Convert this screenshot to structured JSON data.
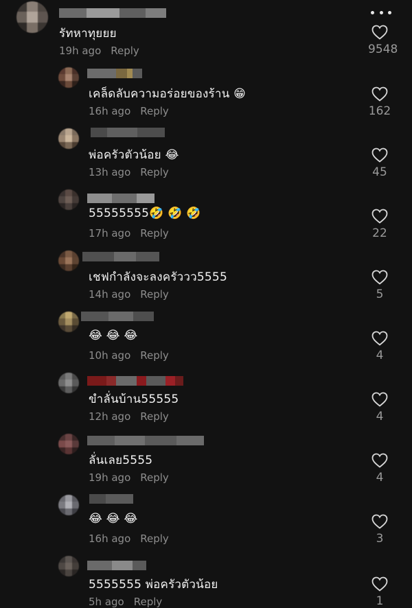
{
  "top_comment": {
    "text": "รัทหาทุยยย",
    "time": "19h ago",
    "reply": "Reply",
    "likes": "9548"
  },
  "replies": [
    {
      "text": "เคล็ดลับความอร่อยของร้าน 😁",
      "time": "16h ago",
      "reply": "Reply",
      "likes": "162"
    },
    {
      "text": "พ่อครัวตัวน้อย 😂",
      "time": "13h ago",
      "reply": "Reply",
      "likes": "45"
    },
    {
      "text": "55555555🤣 🤣 🤣",
      "time": "17h ago",
      "reply": "Reply",
      "likes": "22"
    },
    {
      "text": "เชฟกำลังจะลงครัววว5555",
      "time": "14h ago",
      "reply": "Reply",
      "likes": "5"
    },
    {
      "text": "😂 😂 😂",
      "time": "10h ago",
      "reply": "Reply",
      "likes": "4"
    },
    {
      "text": "ขำลั่นบ้าน55555",
      "time": "12h ago",
      "reply": "Reply",
      "likes": "4"
    },
    {
      "text": "ลั่นเลย5555",
      "time": "19h ago",
      "reply": "Reply",
      "likes": "4"
    },
    {
      "text": "😂 😂 😂",
      "time": "16h ago",
      "reply": "Reply",
      "likes": "3"
    },
    {
      "text": "5555555 พ่อครัวตัวน้อย",
      "time": "5h ago",
      "reply": "Reply",
      "likes": "1"
    }
  ],
  "icons": {
    "like": "heart-icon",
    "more": "more-options-icon"
  }
}
